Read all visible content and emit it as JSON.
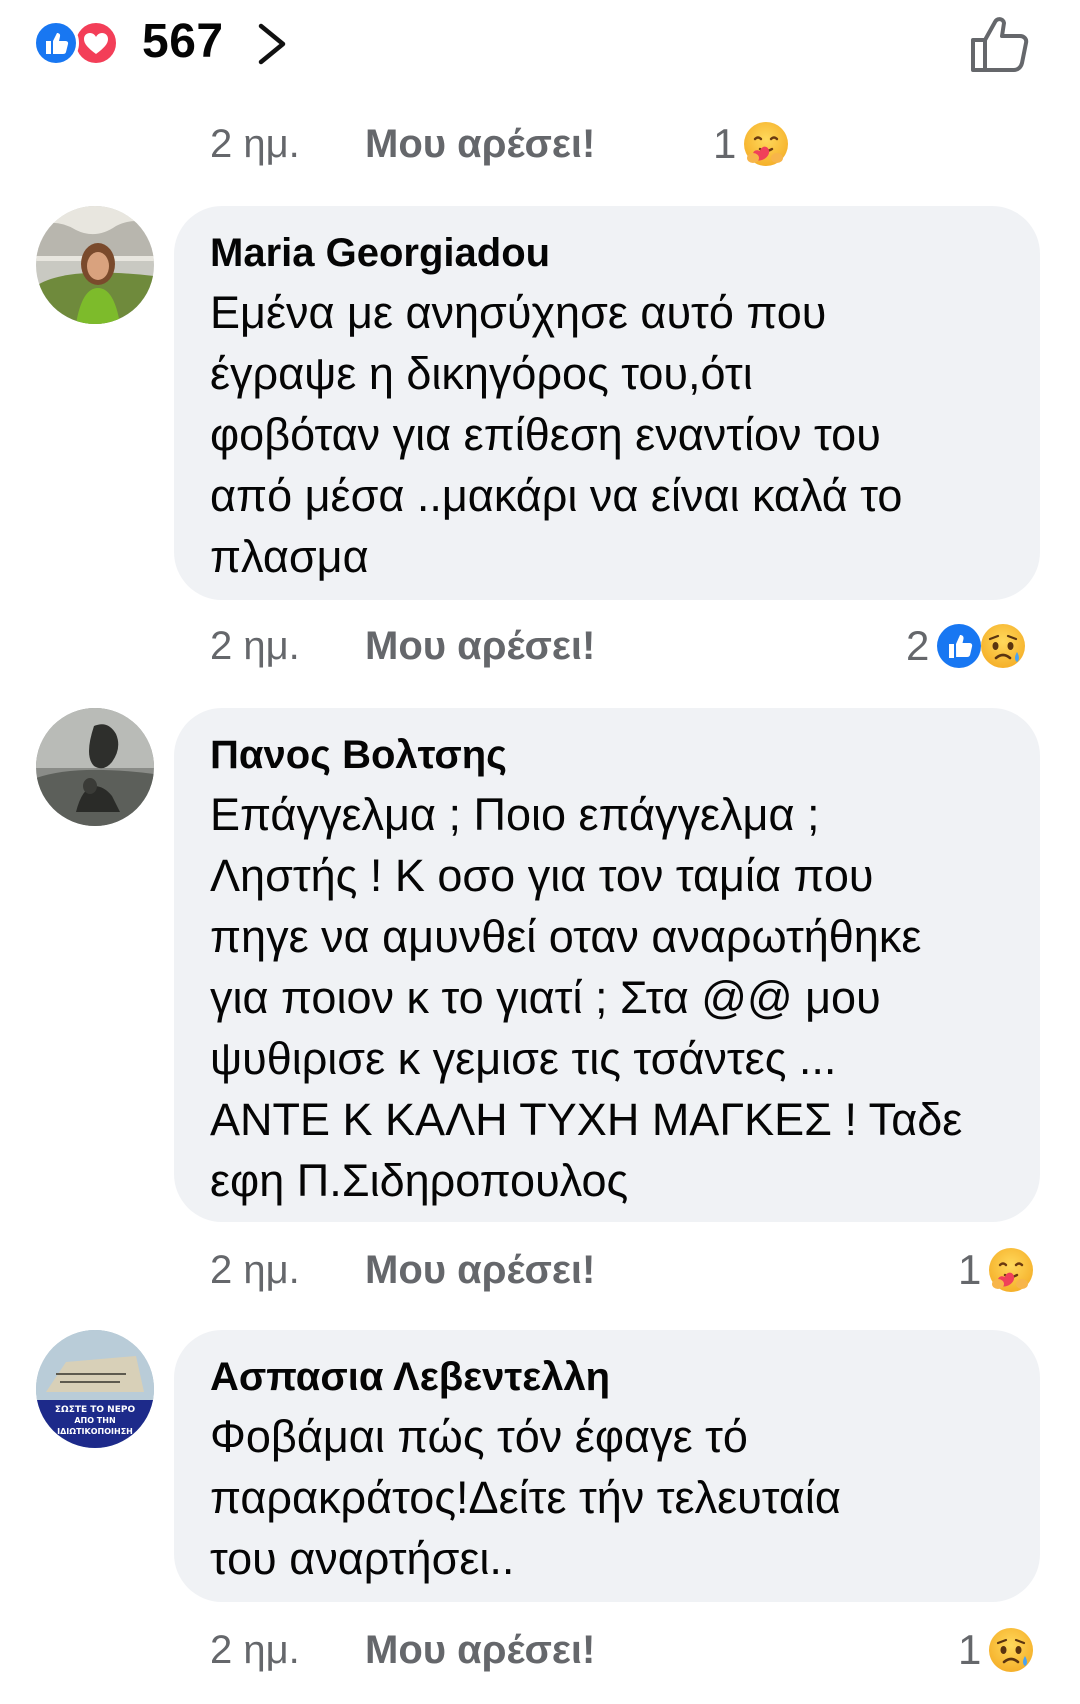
{
  "header": {
    "reaction_icons": [
      "like-reaction",
      "love-reaction"
    ],
    "reaction_count": "567"
  },
  "top_meta": {
    "time": "2 ημ.",
    "like": "Μου αρέσει!",
    "reaction_count": "1",
    "reactions": [
      "care-emoji"
    ]
  },
  "comments": [
    {
      "author": "Maria Georgiadou",
      "text": "Εμένα με ανησύχησε αυτό που\nέγραψε η δικηγόρος του,ότι\nφοβόταν για επίθεση εναντίον του\nαπό μέσα ..μακάρι να είναι καλά το\nπλασμα",
      "time": "2 ημ.",
      "like": "Μου αρέσει!",
      "reaction_count": "2",
      "reactions": [
        "like-emoji",
        "sad-emoji"
      ]
    },
    {
      "author": "Πανος Βολτσης",
      "text": "Επάγγελμα ; Ποιο επάγγελμα ;\nΛηστής ! Κ οσο για τον ταμία που\nπηγε να αμυνθεί οταν αναρωτήθηκε\nγια ποιον κ το γιατί ; Στα @@ μου\nψυθιρισε κ γεμισε τις τσάντες ...\nΑΝΤΕ Κ ΚΑΛΗ ΤΥΧΗ ΜΑΓΚΕΣ ! Ταδε\nεφη Π.Σιδηροπουλος",
      "time": "2 ημ.",
      "like": "Μου αρέσει!",
      "reaction_count": "1",
      "reactions": [
        "care-emoji"
      ]
    },
    {
      "author": "Ασπασια Λεβεντελλη",
      "text": "Φοβάμαι  πώς  τόν έφαγε τό\nπαρακράτος!Δείτε  τήν  τελευταία\nτου αναρτήσει..",
      "time": "2 ημ.",
      "like": "Μου αρέσει!",
      "reaction_count": "1",
      "reactions": [
        "sad-emoji"
      ],
      "avatar_text": "ΣΩΣΤΕ ΤΟ ΝΕΡΟ\nΑΠΟ ΤΗΝ\nΙΔΙΩΤΙΚΟΠΟΙΗΣΗ"
    }
  ],
  "colors": {
    "bubble": "#f0f2f5",
    "meta_text": "#65676b",
    "like_blue": "#1877f2",
    "love_red": "#f33e58",
    "emoji_yellow": "#ffcb4c"
  }
}
